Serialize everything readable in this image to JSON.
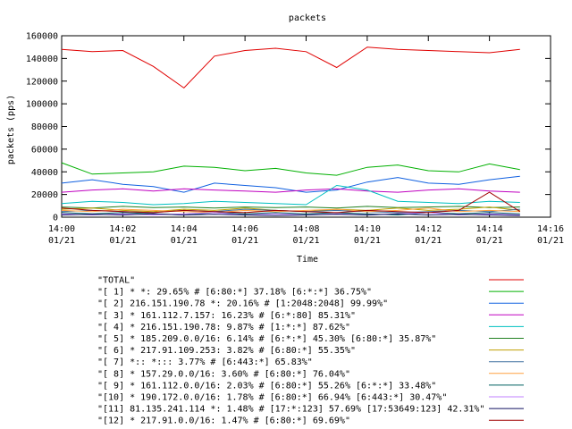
{
  "chart_data": {
    "type": "line",
    "title": "packets",
    "xlabel": "Time",
    "ylabel": "packets (pps)",
    "xlim": [
      "14:00",
      "14:16"
    ],
    "ylim": [
      0,
      160000
    ],
    "yticks": [
      0,
      20000,
      40000,
      60000,
      80000,
      100000,
      120000,
      140000,
      160000
    ],
    "ytick_labels": [
      "0",
      "20000",
      "40000",
      "60000",
      "80000",
      "100000",
      "120000",
      "140000",
      "160000"
    ],
    "xticks": [
      {
        "time": "14:00",
        "date": "01/21"
      },
      {
        "time": "14:02",
        "date": "01/21"
      },
      {
        "time": "14:04",
        "date": "01/21"
      },
      {
        "time": "14:06",
        "date": "01/21"
      },
      {
        "time": "14:08",
        "date": "01/21"
      },
      {
        "time": "14:10",
        "date": "01/21"
      },
      {
        "time": "14:12",
        "date": "01/21"
      },
      {
        "time": "14:14",
        "date": "01/21"
      },
      {
        "time": "14:16",
        "date": "01/21"
      }
    ],
    "grid": false,
    "legend": "below",
    "times": [
      "14:00",
      "14:01",
      "14:02",
      "14:03",
      "14:04",
      "14:05",
      "14:06",
      "14:07",
      "14:08",
      "14:09",
      "14:10",
      "14:11",
      "14:12",
      "14:13",
      "14:14",
      "14:15"
    ],
    "series": [
      {
        "name": "\"TOTAL\"",
        "color": "#e00000",
        "values": [
          148000,
          146000,
          147000,
          133000,
          114000,
          142000,
          147000,
          149000,
          146000,
          132000,
          150000,
          148000,
          147000,
          146000,
          145000,
          148000
        ]
      },
      {
        "name": "\"[ 1] * *: 29.65% # [6:80:*] 37.18% [6:*:*] 36.75%\"",
        "color": "#00b000",
        "values": [
          48000,
          38000,
          39000,
          40000,
          45000,
          44000,
          41000,
          43000,
          39000,
          37000,
          44000,
          46000,
          41000,
          40000,
          47000,
          42000
        ]
      },
      {
        "name": "\"[ 2] 216.151.190.78 *: 20.16% # [1:2048:2048] 99.99%\"",
        "color": "#1060e0",
        "values": [
          30000,
          33000,
          29000,
          27000,
          22000,
          30000,
          28000,
          26000,
          22000,
          24000,
          31000,
          35000,
          30000,
          29000,
          33000,
          36000
        ]
      },
      {
        "name": "\"[ 3] * 161.112.7.157: 16.23% # [6:*:80] 85.31%\"",
        "color": "#c000c0",
        "values": [
          22000,
          24000,
          25000,
          23000,
          25000,
          24000,
          23000,
          22000,
          24000,
          25000,
          23000,
          22000,
          24000,
          25000,
          23000,
          22000
        ]
      },
      {
        "name": "\"[ 4] * 216.151.190.78: 9.87% # [1:*:*] 87.62%\"",
        "color": "#00c0c0",
        "values": [
          12000,
          14000,
          13000,
          11000,
          12000,
          14000,
          13000,
          12000,
          11000,
          28000,
          24000,
          14000,
          13000,
          12000,
          14000,
          13000
        ]
      },
      {
        "name": "\"[ 5] * 185.209.0.0/16: 6.14% # [6:*:*] 45.30% [6:80:*] 35.87%\"",
        "color": "#208020",
        "values": [
          9000,
          8000,
          9500,
          8500,
          9000,
          8000,
          9000,
          8500,
          9000,
          8000,
          9500,
          8500,
          9000,
          9500,
          8500,
          9000
        ]
      },
      {
        "name": "\"[ 6] * 217.91.109.253: 3.82% # [6:80:*] 55.35%\"",
        "color": "#c0a000",
        "values": [
          7000,
          8000,
          6000,
          5000,
          7000,
          6000,
          8000,
          6000,
          5000,
          7000,
          6000,
          8000,
          6000,
          7000,
          9000,
          6000
        ]
      },
      {
        "name": "\"[ 7] *:: *::: 3.77% # [6:443:*] 65.83%\"",
        "color": "#4070a0",
        "values": [
          5000,
          6000,
          5000,
          4000,
          6000,
          5000,
          7000,
          6000,
          5000,
          6000,
          5000,
          4000,
          5000,
          6000,
          5000,
          7000
        ]
      },
      {
        "name": "\"[ 8] * 157.29.0.0/16: 3.60% # [6:80:*] 76.04%\"",
        "color": "#ffa040",
        "values": [
          6000,
          5000,
          7000,
          6000,
          5000,
          4000,
          6000,
          5000,
          6000,
          7000,
          5000,
          6000,
          8000,
          5000,
          6000,
          5000
        ]
      },
      {
        "name": "\"[ 9] * 161.112.0.0/16: 2.03% # [6:80:*] 55.26% [6:*:*] 33.48%\"",
        "color": "#006060",
        "values": [
          4000,
          3000,
          4000,
          3000,
          2000,
          4000,
          3000,
          4000,
          3000,
          4000,
          3000,
          2000,
          4000,
          3000,
          4000,
          3000
        ]
      },
      {
        "name": "\"[10] * 190.172.0.0/16: 1.78% # [6:80:*] 66.94% [6:443:*] 30.47%\"",
        "color": "#c080ff",
        "values": [
          3000,
          2000,
          3000,
          2000,
          3000,
          4000,
          2000,
          3000,
          2000,
          3000,
          2000,
          3000,
          4000,
          2000,
          3000,
          2000
        ]
      },
      {
        "name": "\"[11] 81.135.241.114 *: 1.48% # [17:*:123] 57.69% [17:53649:123] 42.31%\"",
        "color": "#101060",
        "values": [
          2000,
          2500,
          2000,
          3000,
          2000,
          2500,
          2000,
          1500,
          2000,
          2500,
          2000,
          3000,
          2000,
          2500,
          2000,
          1500
        ]
      },
      {
        "name": "\"[12] * 217.91.0.0/16: 1.47% # [6:80:*] 69.69%\"",
        "color": "#a00000",
        "values": [
          8000,
          6000,
          5000,
          4000,
          6000,
          5000,
          4000,
          6000,
          5000,
          4000,
          6000,
          5000,
          4000,
          6000,
          22000,
          5000
        ]
      }
    ]
  }
}
